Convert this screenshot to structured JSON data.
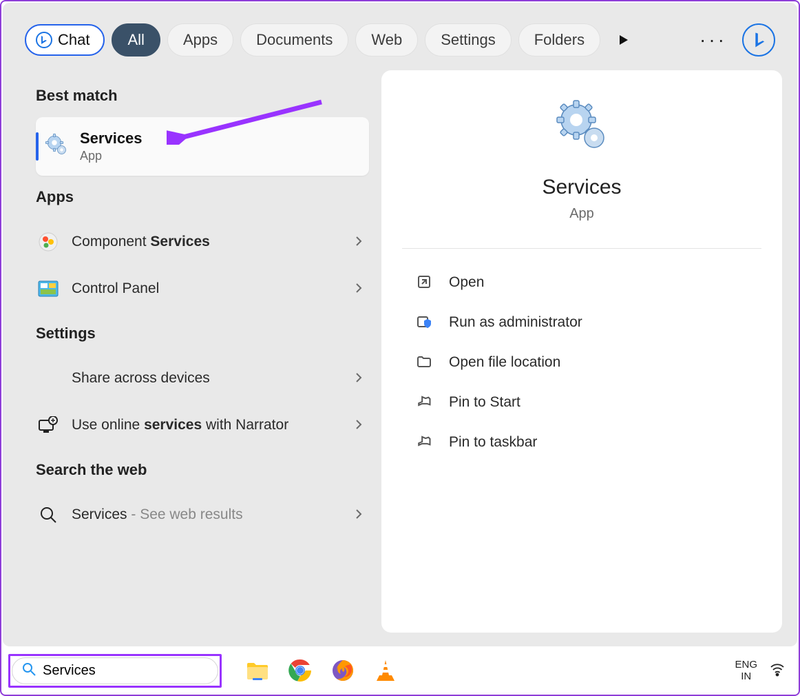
{
  "top": {
    "chat": "Chat",
    "tabs": [
      "All",
      "Apps",
      "Documents",
      "Web",
      "Settings",
      "Folders"
    ],
    "active_tab_index": 0
  },
  "left": {
    "best_match_header": "Best match",
    "best_match": {
      "title": "Services",
      "subtitle": "App"
    },
    "apps_header": "Apps",
    "apps": [
      {
        "prefix": "Component ",
        "bold": "Services",
        "suffix": ""
      },
      {
        "prefix": "Control Panel",
        "bold": "",
        "suffix": ""
      }
    ],
    "settings_header": "Settings",
    "settings": [
      {
        "prefix": "Share across devices",
        "bold": "",
        "suffix": ""
      },
      {
        "prefix": "Use online ",
        "bold": "services",
        "suffix": " with Narrator"
      }
    ],
    "web_header": "Search the web",
    "web": {
      "term": "Services",
      "suffix": " - See web results"
    }
  },
  "right": {
    "title": "Services",
    "subtitle": "App",
    "actions": [
      "Open",
      "Run as administrator",
      "Open file location",
      "Pin to Start",
      "Pin to taskbar"
    ]
  },
  "taskbar": {
    "search_value": "Services",
    "lang1": "ENG",
    "lang2": "IN"
  }
}
